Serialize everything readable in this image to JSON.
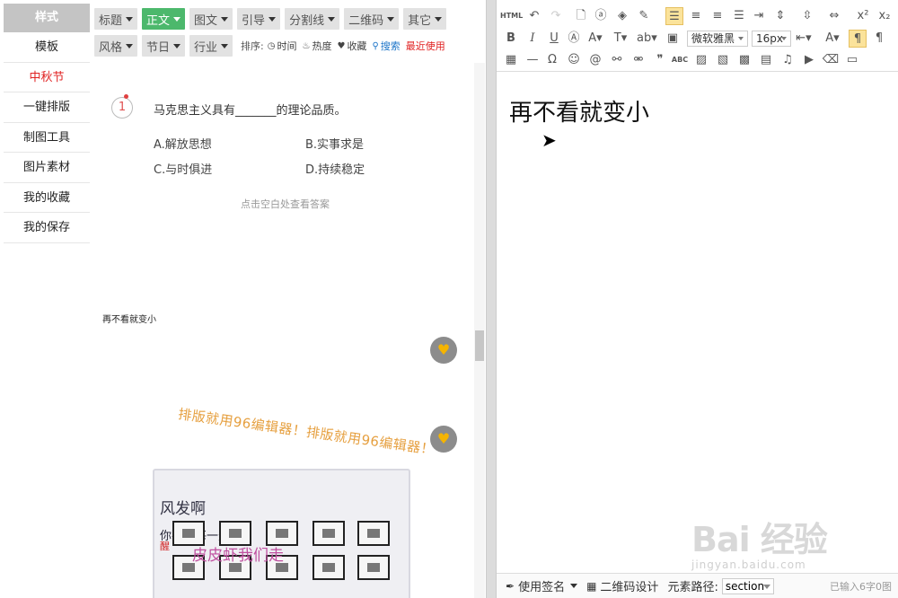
{
  "sidebar": {
    "header": "样式",
    "items": [
      {
        "label": "模板"
      },
      {
        "label": "中秋节"
      },
      {
        "label": "一键排版"
      },
      {
        "label": "制图工具"
      },
      {
        "label": "图片素材"
      },
      {
        "label": "我的收藏"
      },
      {
        "label": "我的保存"
      }
    ]
  },
  "filters": {
    "row1": [
      "标题",
      "正文",
      "图文",
      "引导",
      "分割线",
      "二维码",
      "其它"
    ],
    "row2": [
      "风格",
      "节日",
      "行业"
    ],
    "active": "正文"
  },
  "sort": {
    "label": "排序:",
    "time": "时间",
    "hot": "热度",
    "favorites": "收藏",
    "search": "搜索",
    "recent": "最近使用"
  },
  "question": {
    "number": "1",
    "text": "马克思主义具有_______的理论品质。",
    "options": [
      "A.解放思想",
      "B.实事求是",
      "C.与时俱进",
      "D.持续稳定"
    ],
    "hint": "点击空白处查看答案"
  },
  "preview": {
    "small_text": "再不看就变小",
    "slogan": "排版就用96编辑器！排版就用96编辑器！",
    "image_text_1": "风发啊",
    "image_text_2": "你要好每一天",
    "image_text_3": "皮皮虾我们走",
    "image_text_4": "醒"
  },
  "editor": {
    "toolbar": {
      "html": "HTML",
      "font": "微软雅黑",
      "size": "16px"
    },
    "content": "再不看就变小",
    "bottom": {
      "signature": "使用签名",
      "qrcode": "二维码设计",
      "path_label": "元素路径:",
      "path_value": "section",
      "count": "已输入6字0图"
    }
  },
  "watermark": {
    "main": "Bai 经验",
    "sub": "jingyan.baidu.com"
  },
  "colors": {
    "accent_green": "#4cb86c",
    "active_red": "#e02020",
    "heart_orange": "#f5b400",
    "slogan_orange": "#e6a040",
    "toolbar_active": "#fbe39b"
  }
}
